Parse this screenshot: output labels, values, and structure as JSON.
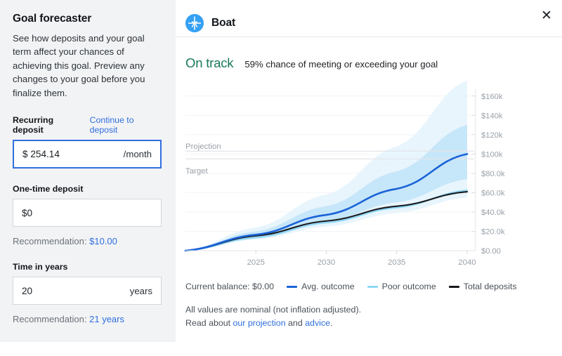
{
  "sidebar": {
    "title": "Goal forecaster",
    "description": "See how deposits and your goal term affect your chances of achieving this goal. Preview any changes to your goal before you finalize them.",
    "fields": [
      {
        "label": "Recurring deposit",
        "link": "Continue to deposit",
        "value": "$ 254.14",
        "placeholder": "$ 0.00",
        "suffix": "/month",
        "focused": true
      },
      {
        "label": "One-time deposit",
        "link": "",
        "value": "$0",
        "placeholder": "$0",
        "suffix": "",
        "focused": false,
        "recommendation_prefix": "Recommendation: ",
        "recommendation_value": "$10.00"
      },
      {
        "label": "Time in years",
        "link": "",
        "value": "20",
        "placeholder": "0",
        "suffix": "years",
        "focused": false,
        "recommendation_prefix": "Recommendation: ",
        "recommendation_value": "21 years"
      }
    ]
  },
  "header": {
    "goal_name": "Boat",
    "goal_icon": "boat-icon",
    "close_icon": "✕"
  },
  "status": {
    "label": "On track",
    "label_color": "#197a56",
    "detail": "59% chance of meeting or exceeding your goal"
  },
  "chart_data": {
    "type": "area",
    "title": "",
    "xlabel": "",
    "ylabel": "",
    "x": [
      2020,
      2025,
      2030,
      2035,
      2040
    ],
    "xticks": [
      "2025",
      "2030",
      "2035",
      "2040"
    ],
    "xtick_values": [
      2025,
      2030,
      2035,
      2040
    ],
    "xlim": [
      2020,
      2040.5
    ],
    "yticks": [
      "$0.00",
      "$20.0k",
      "$40.0k",
      "$60.0k",
      "$80.0k",
      "$100k",
      "$120k",
      "$140k",
      "$160k"
    ],
    "ytick_values": [
      0,
      20000,
      40000,
      60000,
      80000,
      100000,
      120000,
      140000,
      160000
    ],
    "ylim": [
      0,
      170000
    ],
    "grid": true,
    "legend_position": "bottom",
    "annotations": [
      {
        "name": "Projection",
        "value": 103000
      },
      {
        "name": "Target",
        "value": 95000
      }
    ],
    "series": [
      {
        "name": "Avg. outcome",
        "color": "#1a63d8",
        "values": [
          0,
          16500,
          37000,
          64000,
          100000
        ]
      },
      {
        "name": "Poor outcome",
        "color": "#8fd8f8",
        "values": [
          0,
          13500,
          29000,
          44500,
          62500
        ]
      },
      {
        "name": "Total deposits",
        "color": "#17191c",
        "values": [
          0,
          15400,
          30700,
          46000,
          61000
        ]
      }
    ],
    "bands": [
      {
        "name": "outer-range",
        "color": "#e8f5fd",
        "upper": [
          0,
          24000,
          58000,
          108000,
          176000
        ],
        "lower": [
          0,
          11500,
          25000,
          39000,
          55000
        ]
      },
      {
        "name": "inner-range",
        "color": "#c6e6f9",
        "upper": [
          0,
          20000,
          46000,
          82000,
          130000
        ],
        "lower": [
          0,
          13500,
          30500,
          50000,
          74000
        ]
      }
    ],
    "legend": [
      {
        "kind": "text",
        "label": "Current balance: $0.00"
      },
      {
        "kind": "line",
        "label": "Avg. outcome",
        "color": "#1a63d8"
      },
      {
        "kind": "line",
        "label": "Poor outcome",
        "color": "#8fd8f8"
      },
      {
        "kind": "line",
        "label": "Total deposits",
        "color": "#17191c"
      }
    ]
  },
  "footnote": {
    "line1": "All values are nominal (not inflation adjusted).",
    "line2_prefix": "Read about ",
    "link1": "our projection",
    "line2_middle": " and ",
    "link2": "advice",
    "line2_suffix": "."
  }
}
